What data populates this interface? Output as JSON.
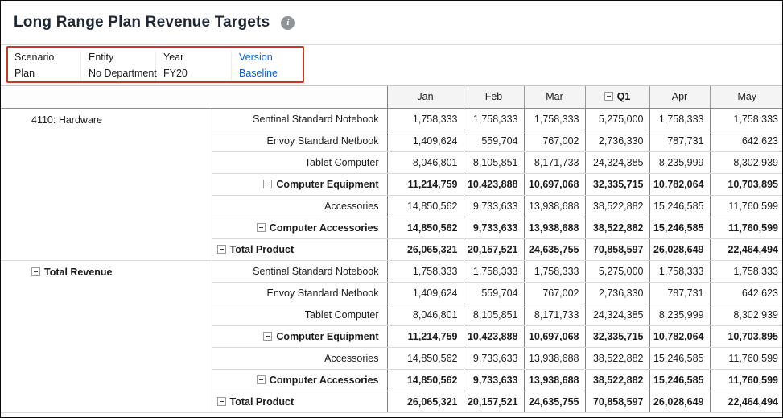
{
  "colors": {
    "link_blue": "#0b63c4",
    "pov_highlight_red": "#cb3721",
    "grid_line_dark": "#808080",
    "grid_line_light": "#d9d9d9"
  },
  "header": {
    "title": "Long Range Plan Revenue Targets",
    "info_icon": "i"
  },
  "pov": {
    "items": [
      {
        "label": "Scenario",
        "value": "Plan",
        "link": false
      },
      {
        "label": "Entity",
        "value": "No Department",
        "link": false
      },
      {
        "label": "Year",
        "value": "FY20",
        "link": false
      },
      {
        "label": "Version",
        "value": "Baseline",
        "link": true
      }
    ]
  },
  "grid": {
    "columns": [
      {
        "label": "Jan",
        "bold": false,
        "collapse": false
      },
      {
        "label": "Feb",
        "bold": false,
        "collapse": false
      },
      {
        "label": "Mar",
        "bold": false,
        "collapse": false
      },
      {
        "label": "Q1",
        "bold": true,
        "collapse": true
      },
      {
        "label": "Apr",
        "bold": false,
        "collapse": false
      },
      {
        "label": "May",
        "bold": false,
        "collapse": false
      }
    ],
    "row_groups": [
      {
        "label": "4110: Hardware",
        "bold": false,
        "collapse": false,
        "span": 7
      },
      {
        "label": "Total Revenue",
        "bold": true,
        "collapse": true,
        "span": 7
      }
    ],
    "rows": [
      {
        "label": "Sentinal Standard Notebook",
        "bold": false,
        "collapse": false,
        "align": "right",
        "values": [
          "1,758,333",
          "1,758,333",
          "1,758,333",
          "5,275,000",
          "1,758,333",
          "1,758,333"
        ]
      },
      {
        "label": "Envoy Standard Netbook",
        "bold": false,
        "collapse": false,
        "align": "right",
        "values": [
          "1,409,624",
          "559,704",
          "767,002",
          "2,736,330",
          "787,731",
          "642,623"
        ]
      },
      {
        "label": "Tablet Computer",
        "bold": false,
        "collapse": false,
        "align": "right",
        "values": [
          "8,046,801",
          "8,105,851",
          "8,171,733",
          "24,324,385",
          "8,235,999",
          "8,302,939"
        ]
      },
      {
        "label": "Computer Equipment",
        "bold": true,
        "collapse": true,
        "align": "right",
        "values": [
          "11,214,759",
          "10,423,888",
          "10,697,068",
          "32,335,715",
          "10,782,064",
          "10,703,895"
        ]
      },
      {
        "label": "Accessories",
        "bold": false,
        "collapse": false,
        "align": "right",
        "values": [
          "14,850,562",
          "9,733,633",
          "13,938,688",
          "38,522,882",
          "15,246,585",
          "11,760,599"
        ]
      },
      {
        "label": "Computer Accessories",
        "bold": true,
        "collapse": true,
        "align": "right",
        "values": [
          "14,850,562",
          "9,733,633",
          "13,938,688",
          "38,522,882",
          "15,246,585",
          "11,760,599"
        ]
      },
      {
        "label": "Total Product",
        "bold": true,
        "collapse": true,
        "align": "left",
        "values": [
          "26,065,321",
          "20,157,521",
          "24,635,755",
          "70,858,597",
          "26,028,649",
          "22,464,494"
        ]
      },
      {
        "label": "Sentinal Standard Notebook",
        "bold": false,
        "collapse": false,
        "align": "right",
        "values": [
          "1,758,333",
          "1,758,333",
          "1,758,333",
          "5,275,000",
          "1,758,333",
          "1,758,333"
        ]
      },
      {
        "label": "Envoy Standard Netbook",
        "bold": false,
        "collapse": false,
        "align": "right",
        "values": [
          "1,409,624",
          "559,704",
          "767,002",
          "2,736,330",
          "787,731",
          "642,623"
        ]
      },
      {
        "label": "Tablet Computer",
        "bold": false,
        "collapse": false,
        "align": "right",
        "values": [
          "8,046,801",
          "8,105,851",
          "8,171,733",
          "24,324,385",
          "8,235,999",
          "8,302,939"
        ]
      },
      {
        "label": "Computer Equipment",
        "bold": true,
        "collapse": true,
        "align": "right",
        "values": [
          "11,214,759",
          "10,423,888",
          "10,697,068",
          "32,335,715",
          "10,782,064",
          "10,703,895"
        ]
      },
      {
        "label": "Accessories",
        "bold": false,
        "collapse": false,
        "align": "right",
        "values": [
          "14,850,562",
          "9,733,633",
          "13,938,688",
          "38,522,882",
          "15,246,585",
          "11,760,599"
        ]
      },
      {
        "label": "Computer Accessories",
        "bold": true,
        "collapse": true,
        "align": "right",
        "values": [
          "14,850,562",
          "9,733,633",
          "13,938,688",
          "38,522,882",
          "15,246,585",
          "11,760,599"
        ]
      },
      {
        "label": "Total Product",
        "bold": true,
        "collapse": true,
        "align": "left",
        "values": [
          "26,065,321",
          "20,157,521",
          "24,635,755",
          "70,858,597",
          "26,028,649",
          "22,464,494"
        ]
      }
    ]
  }
}
